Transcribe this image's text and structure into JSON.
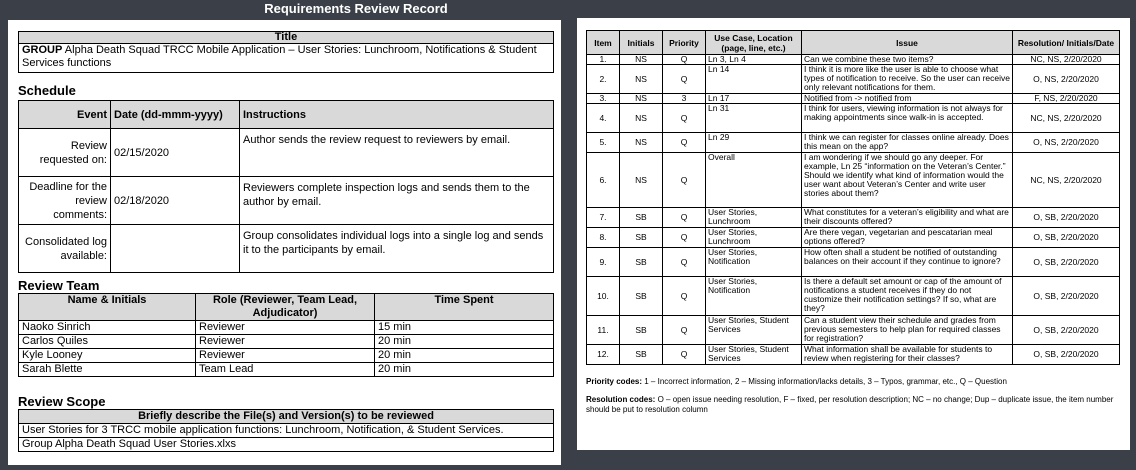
{
  "header": {
    "title": "Requirements Review Record"
  },
  "title_section": {
    "header": "Title",
    "group_label": "GROUP",
    "text": "Alpha Death Squad TRCC Mobile Application – User Stories: Lunchroom, Notifications & Student Services functions"
  },
  "schedule": {
    "heading": "Schedule",
    "columns": [
      "Event",
      "Date (dd-mmm-yyyy)",
      "Instructions"
    ],
    "rows": [
      {
        "event": "Review requested on:",
        "date": "02/15/2020",
        "instructions": "Author sends the review request to reviewers by email."
      },
      {
        "event": "Deadline for the review comments:",
        "date": "02/18/2020",
        "instructions": "Reviewers complete inspection logs and sends them to the author by email."
      },
      {
        "event": "Consolidated log available:",
        "date": "",
        "instructions": "Group consolidates individual logs into a single log and sends it to the participants by email."
      }
    ]
  },
  "review_team": {
    "heading": "Review Team",
    "columns": [
      "Name & Initials",
      "Role (Reviewer, Team Lead, Adjudicator)",
      "Time Spent"
    ],
    "rows": [
      {
        "name": "Naoko Sinrich",
        "role": "Reviewer",
        "time": "15 min"
      },
      {
        "name": "Carlos Quiles",
        "role": "Reviewer",
        "time": "20 min"
      },
      {
        "name": "Kyle Looney",
        "role": "Reviewer",
        "time": "20 min"
      },
      {
        "name": "Sarah Blette",
        "role": "Team Lead",
        "time": "20 min"
      }
    ]
  },
  "review_scope": {
    "heading": "Review Scope",
    "header": "Briefly describe the File(s) and Version(s) to be reviewed",
    "lines": [
      "User Stories for 3 TRCC mobile application functions: Lunchroom, Notification, & Student Services.",
      "Group Alpha Death Squad User Stories.xlxs"
    ]
  },
  "issue_log": {
    "columns": [
      "Item",
      "Initials",
      "Priority",
      "Use Case, Location (page, line, etc.)",
      "Issue",
      "Resolution/ Initials/Date"
    ],
    "rows": [
      {
        "item": "1.",
        "initials": "NS",
        "priority": "Q",
        "location": "Ln 3, Ln 4",
        "issue": "Can we combine these two items?",
        "resolution": "NC, NS, 2/20/2020"
      },
      {
        "item": "2.",
        "initials": "NS",
        "priority": "Q",
        "location": "Ln 14",
        "issue": "I think it is more like the user is able to choose what types of notification to receive. So the user can receive only relevant notifications for them.",
        "resolution": "O, NS, 2/20/2020"
      },
      {
        "item": "3.",
        "initials": "NS",
        "priority": "3",
        "location": "Ln 17",
        "issue": "Notified from -> notified from",
        "resolution": "F, NS, 2/20/2020"
      },
      {
        "item": "4.",
        "initials": "NS",
        "priority": "Q",
        "location": "Ln 31",
        "issue": "I think for users, viewing information is not always for making appointments since walk-in is accepted.",
        "resolution": "NC, NS, 2/20/2020"
      },
      {
        "item": "5.",
        "initials": "NS",
        "priority": "Q",
        "location": "Ln 29",
        "issue": "I think we can register for classes online already. Does this mean on the app?",
        "resolution": "O, NS, 2/20/2020"
      },
      {
        "item": "6.",
        "initials": "NS",
        "priority": "Q",
        "location": "Overall",
        "issue": "I am wondering if we should go any deeper. For example, Ln 25 “information on the Veteran’s Center.” Should we identify what kind of information would the user want about Veteran’s Center and write user stories about them?",
        "resolution": "NC, NS, 2/20/2020"
      },
      {
        "item": "7.",
        "initials": "SB",
        "priority": "Q",
        "location": "User Stories, Lunchroom",
        "issue": "What constitutes for a veteran’s eligibility and what are their discounts offered?",
        "resolution": "O, SB, 2/20/2020"
      },
      {
        "item": "8.",
        "initials": "SB",
        "priority": "Q",
        "location": "User Stories, Lunchroom",
        "issue": "Are there vegan, vegetarian and pescatarian meal options offered?",
        "resolution": "O, SB, 2/20/2020"
      },
      {
        "item": "9.",
        "initials": "SB",
        "priority": "Q",
        "location": "User Stories, Notification",
        "issue": "How often shall a student be notified of outstanding balances on their account if they continue to ignore?",
        "resolution": "O, SB, 2/20/2020"
      },
      {
        "item": "10.",
        "initials": "SB",
        "priority": "Q",
        "location": "User Stories, Notification",
        "issue": "Is there a default set amount or cap of the amount of notifications a student receives if they do not customize their notification settings? If so, what are they?",
        "resolution": "O, SB, 2/20/2020"
      },
      {
        "item": "11.",
        "initials": "SB",
        "priority": "Q",
        "location": "User Stories, Student Services",
        "issue": "Can a student view their schedule and grades from previous semesters to help plan for required classes for registration?",
        "resolution": "O, SB, 2/20/2020"
      },
      {
        "item": "12.",
        "initials": "SB",
        "priority": "Q",
        "location": "User Stories, Student Services",
        "issue": "What information shall be available for students to review when registering for their classes?",
        "resolution": "O, SB, 2/20/2020"
      }
    ]
  },
  "codes": {
    "priority_label": "Priority codes:",
    "priority_text": "1 – Incorrect information, 2 – Missing information/lacks details, 3 – Typos, grammar, etc., Q – Question",
    "resolution_label": "Resolution codes:",
    "resolution_text": "O – open issue needing resolution, F – fixed, per resolution description; NC – no change; Dup – duplicate issue, the item number should be put to resolution column"
  }
}
